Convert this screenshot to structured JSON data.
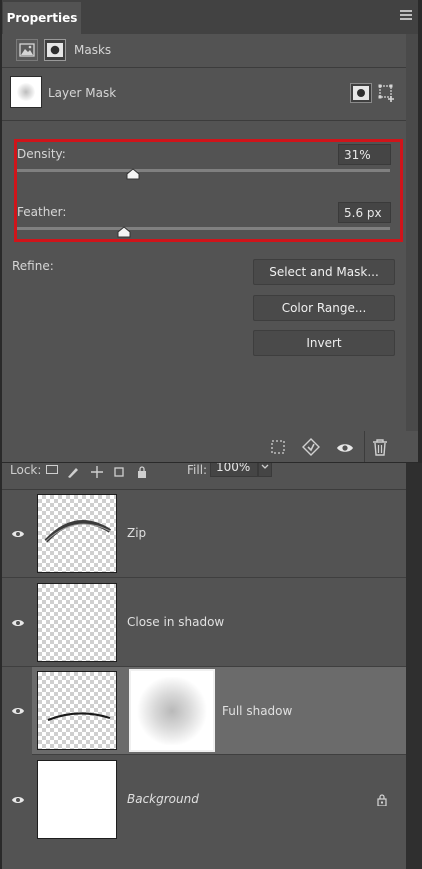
{
  "properties": {
    "tab_label": "Properties",
    "masks_label": "Masks",
    "mask_type_label": "Layer Mask",
    "density": {
      "label": "Density:",
      "value": "31%",
      "level": 0.31
    },
    "feather": {
      "label": "Feather:",
      "value": "5.6 px",
      "level": 0.29
    },
    "refine_label": "Refine:",
    "buttons": {
      "select_and_mask": "Select and Mask...",
      "color_range": "Color Range...",
      "invert": "Invert"
    }
  },
  "layers_panel": {
    "lock_label": "Lock:",
    "fill_label": "Fill:",
    "fill_value": "100%",
    "layers": [
      {
        "name": "Zip",
        "visible": true
      },
      {
        "name": "Close in shadow",
        "visible": true
      },
      {
        "name": "Full shadow",
        "visible": true,
        "selected": true,
        "has_mask": true
      },
      {
        "name": "Background",
        "visible": true,
        "locked": true
      }
    ]
  },
  "colors": {
    "highlight_box": "#d0141a",
    "selected_row": "#6b6b6b",
    "panel_bg": "#535353"
  }
}
